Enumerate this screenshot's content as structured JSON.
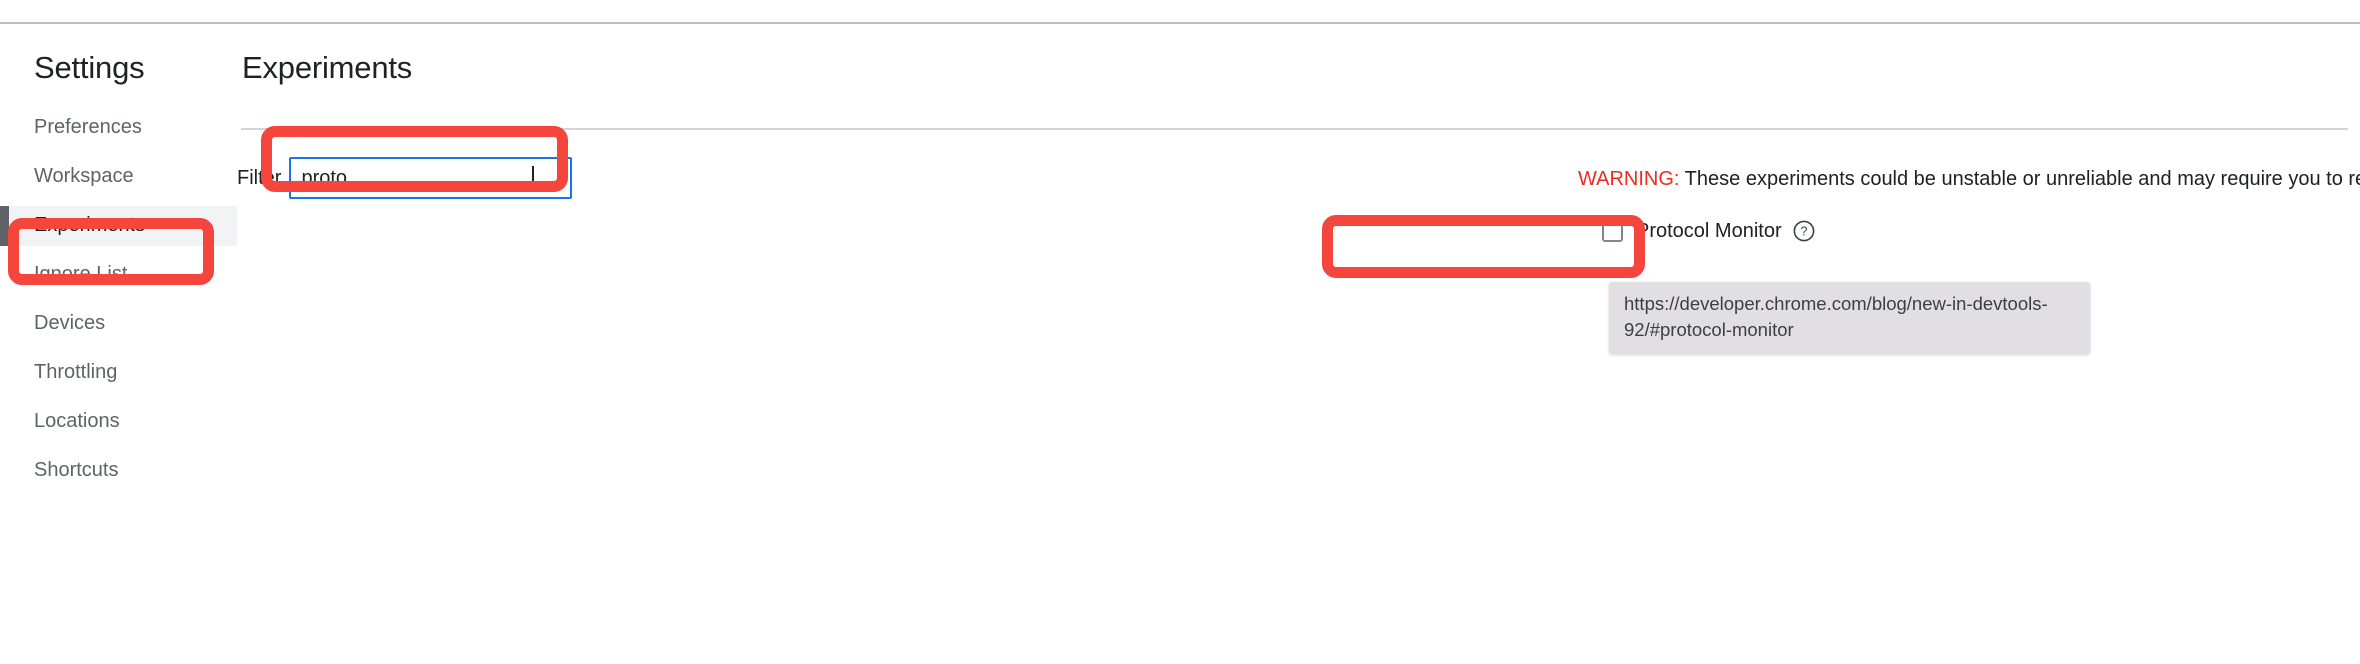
{
  "sidebar": {
    "title": "Settings",
    "items": [
      {
        "label": "Preferences",
        "selected": false
      },
      {
        "label": "Workspace",
        "selected": false
      },
      {
        "label": "Experiments",
        "selected": true
      },
      {
        "label": "Ignore List",
        "selected": false
      },
      {
        "label": "Devices",
        "selected": false
      },
      {
        "label": "Throttling",
        "selected": false
      },
      {
        "label": "Locations",
        "selected": false
      },
      {
        "label": "Shortcuts",
        "selected": false
      }
    ]
  },
  "main": {
    "title": "Experiments",
    "filter": {
      "label": "Filter",
      "value": "proto",
      "placeholder": ""
    },
    "warning": {
      "prefix": "WARNING:",
      "text": " These experiments could be unstable or unreliable and may require you to restart DevTools.",
      "color": "#ee2b20"
    },
    "experiments": [
      {
        "label": "Protocol Monitor",
        "checked": false,
        "help_icon": "question-mark-circle-icon"
      }
    ]
  },
  "tooltip": {
    "text": "https://developer.chrome.com/blog/new-in-devtools-92/#protocol-monitor",
    "background": "#e1dfe4"
  },
  "annotations": {
    "color": "#f4463c",
    "boxes": [
      {
        "name": "sidebar-experiments-highlight"
      },
      {
        "name": "filter-input-highlight"
      },
      {
        "name": "protocol-monitor-highlight"
      }
    ]
  }
}
